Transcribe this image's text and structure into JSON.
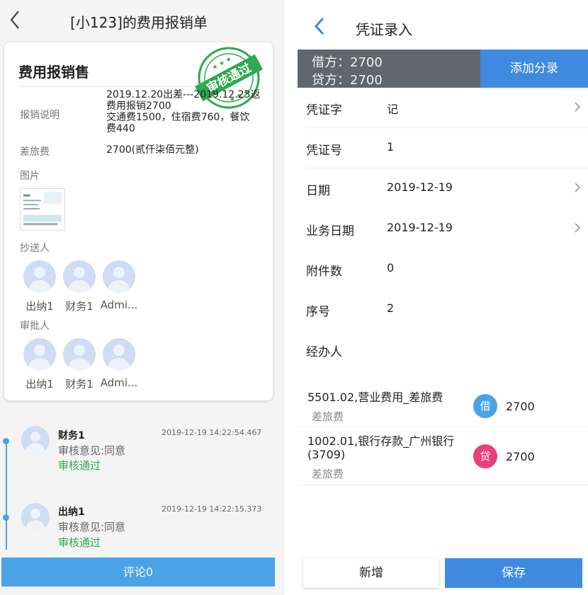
{
  "left": {
    "header": {
      "title": "[小123]的费用报销单"
    },
    "card": {
      "title": "费用报销售",
      "stamp_text": "审核通过",
      "desc_label": "报销说明",
      "desc_lines": [
        "2019.12.20出差---2019.12.23返",
        "费用报销2700",
        "交通费1500，住宿费760，餐饮",
        "费440"
      ],
      "expense_label": "差旅费",
      "expense_value": "2700(贰仟柒佰元整)",
      "images_label": "图片",
      "cc_label": "抄送人",
      "cc_people": [
        "出纳1",
        "财务1",
        "Admi..."
      ],
      "approver_label": "审批人",
      "approvers": [
        "出纳1",
        "财务1",
        "Admi..."
      ]
    },
    "timeline": [
      {
        "name": "财务1",
        "time": "2019-12-19 14:22:54.467",
        "opinion": "审核意见:同意",
        "status": "审核通过"
      },
      {
        "name": "出纳1",
        "time": "2019-12-19 14:22:15.373",
        "opinion": "审核意见:同意",
        "status": "审核通过"
      }
    ],
    "comment_button": "评论0",
    "colors": {
      "accent": "#4aa3e6",
      "approved": "#2fa84f"
    }
  },
  "right": {
    "header": {
      "title": "凭证录入"
    },
    "summary": {
      "debit": "借方：2700",
      "credit": "贷方：2700"
    },
    "add_entry_button": "添加分录",
    "fields": [
      {
        "label": "凭证字",
        "value": "记",
        "chevron": true
      },
      {
        "label": "凭证号",
        "value": "1",
        "chevron": false
      },
      {
        "label": "日期",
        "value": "2019-12-19",
        "chevron": true
      },
      {
        "label": "业务日期",
        "value": "2019-12-19",
        "chevron": true
      },
      {
        "label": "附件数",
        "value": "0",
        "chevron": false
      },
      {
        "label": "序号",
        "value": "2",
        "chevron": false
      },
      {
        "label": "经办人",
        "value": "",
        "chevron": false
      }
    ],
    "entries": [
      {
        "account_lines": [
          "5501.02,营业费用_差旅费"
        ],
        "summary": "差旅费",
        "badge": "借",
        "amount": "2700"
      },
      {
        "account_lines": [
          "1002.01,银行存款_广州银行",
          "(3709)"
        ],
        "summary": "差旅费",
        "badge": "贷",
        "amount": "2700"
      }
    ],
    "buttons": {
      "new": "新增",
      "save": "保存"
    },
    "colors": {
      "primary": "#3f8ae0",
      "debit_badge": "#4aa3e6",
      "credit_badge": "#e8407a"
    }
  }
}
